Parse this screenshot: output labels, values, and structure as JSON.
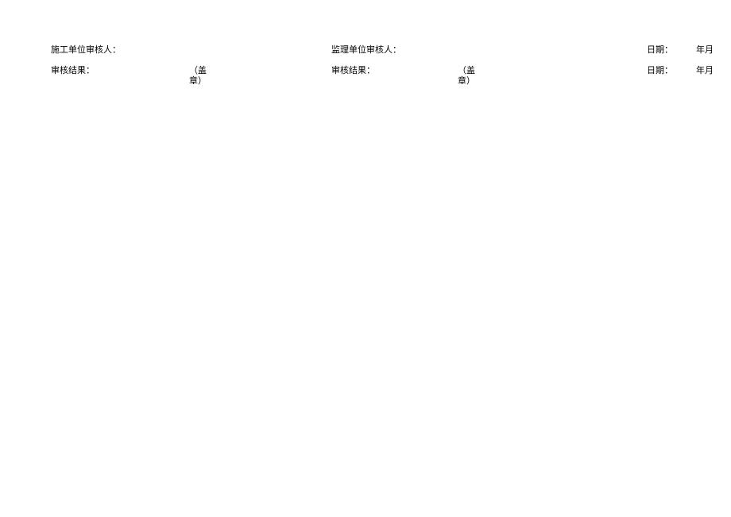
{
  "row1": {
    "col1": "施工单位审核人：",
    "col3": "监理单位审核人：",
    "col5": "日期：",
    "col6": "年月"
  },
  "row2": {
    "col1": "审核结果：",
    "col2_line1": "（盖",
    "col2_line2": "章）",
    "col3": "审核结果：",
    "col4_line1": "（盖",
    "col4_line2": "章）",
    "col5": "日期：",
    "col6": "年月"
  }
}
